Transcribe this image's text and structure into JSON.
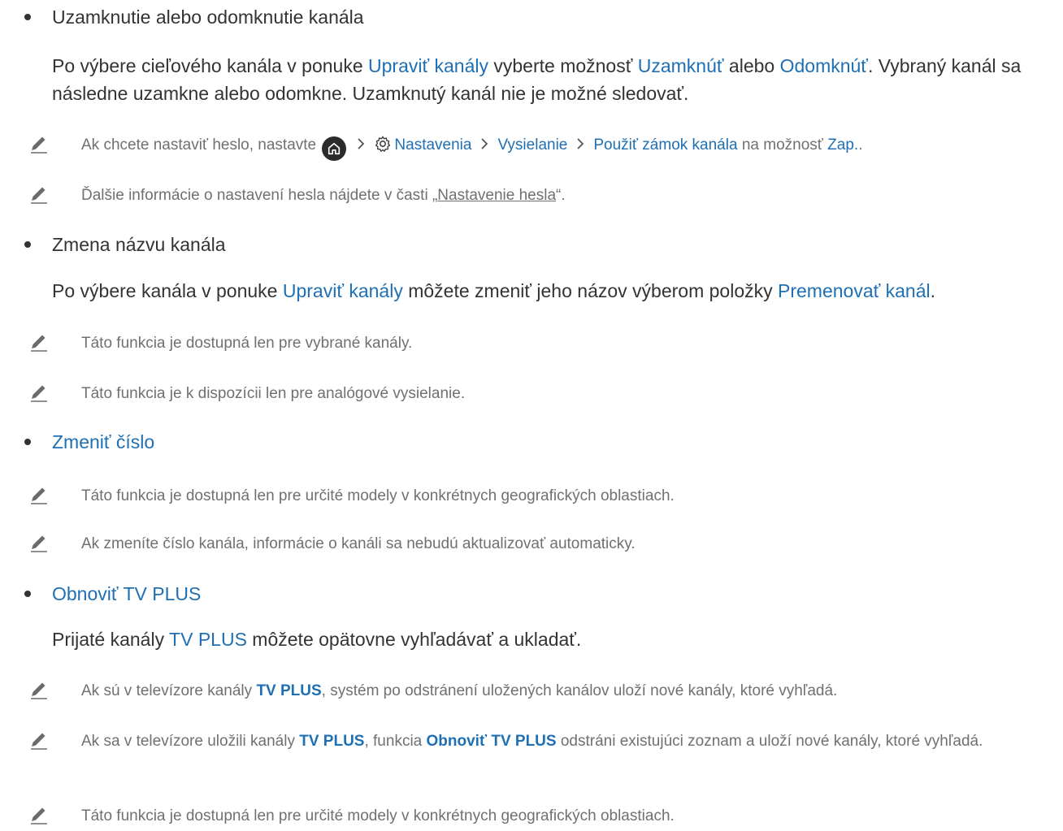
{
  "sections": {
    "lock": {
      "bullet": "Uzamknutie alebo odomknutie kanála",
      "para": {
        "t1": "Po výbere cieľového kanála v ponuke ",
        "h1": "Upraviť kanály",
        "t2": " vyberte možnosť ",
        "h2": "Uzamknúť",
        "t3": " alebo ",
        "h3": "Odomknúť",
        "t4": ". Vybraný kanál sa následne uzamkne alebo odomkne. Uzamknutý kanál nie je možné sledovať."
      },
      "note1": {
        "t1": "Ak chcete nastaviť heslo, nastavte ",
        "settings": "Nastavenia",
        "broadcast": "Vysielanie",
        "apply_lock": "Použiť zámok kanála",
        "t2": " na možnosť ",
        "on": "Zap.",
        "t3": "."
      },
      "note2": {
        "t1": "Ďalšie informácie o nastavení hesla nájdete v časti „",
        "link": "Nastavenie hesla",
        "t2": "“."
      }
    },
    "rename": {
      "bullet": "Zmena názvu kanála",
      "para": {
        "t1": "Po výbere kanála v ponuke ",
        "h1": "Upraviť kanály",
        "t2": " môžete zmeniť jeho názov výberom položky ",
        "h2": "Premenovať kanál",
        "t3": "."
      },
      "note1": "Táto funkcia je dostupná len pre vybrané kanály.",
      "note2": "Táto funkcia je k dispozícii len pre analógové vysielanie."
    },
    "number": {
      "bullet": "Zmeniť číslo",
      "note1": "Táto funkcia je dostupná len pre určité modely v konkrétnych geografických oblastiach.",
      "note2": "Ak zmeníte číslo kanála, informácie o kanáli sa nebudú aktualizovať automaticky."
    },
    "tvplus": {
      "bullet": "Obnoviť TV PLUS",
      "para": {
        "t1": "Prijaté kanály ",
        "h1": "TV PLUS",
        "t2": " môžete opätovne vyhľadávať a ukladať."
      },
      "note1": {
        "t1": "Ak sú v televízore kanály ",
        "h1": "TV PLUS",
        "t2": ", systém po odstránení uložených kanálov uloží nové kanály, ktoré vyhľadá."
      },
      "note2": {
        "t1": "Ak sa v televízore uložili kanály ",
        "h1": "TV PLUS",
        "t2": ", funkcia ",
        "h2": "Obnoviť TV PLUS",
        "t3": " odstráni existujúci zoznam a uloží nové kanály, ktoré vyhľadá."
      },
      "note3": "Táto funkcia je dostupná len pre určité modely v konkrétnych geografických oblastiach."
    }
  },
  "colors": {
    "accent": "#1f6fb4",
    "note_text": "#707070",
    "body_text": "#333333"
  },
  "icons": {
    "note": "pencil-icon",
    "home": "home-icon",
    "settings": "gear-icon",
    "separator": "chevron-right-icon"
  }
}
